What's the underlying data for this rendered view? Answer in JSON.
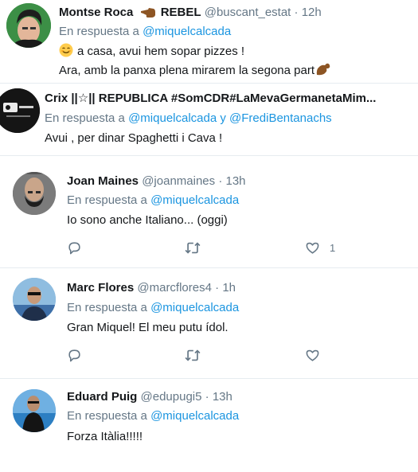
{
  "tweets": [
    {
      "name": "Montse Roca",
      "name_suffix": "REBEL",
      "handle": "@buscant_estat",
      "time": "12h",
      "reply_prefix": "En respuesta a",
      "reply_to": "@miquelcalcada",
      "line1": "a casa, avui hem sopar pizzes !",
      "line2": "Ara, amb la panxa plena mirarem la segona part"
    },
    {
      "name": "Crix ||☆|| REPUBLICA #SomCDR#LaMevaGermanetaMim...",
      "reply_prefix": "En respuesta a",
      "reply_to": "@miquelcalcada",
      "reply_and": "y",
      "reply_to2": "@FrediBentanachs",
      "line1": "Avui , per dinar Spaghetti i Cava !"
    },
    {
      "name": "Joan Maines",
      "handle": "@joanmaines",
      "time": "13h",
      "reply_prefix": "En respuesta a",
      "reply_to": "@miquelcalcada",
      "line1": "Io sono anche Italiano... (oggi)",
      "like_count": "1"
    },
    {
      "name": "Marc Flores",
      "handle": "@marcflores4",
      "time": "1h",
      "reply_prefix": "En respuesta a",
      "reply_to": "@miquelcalcada",
      "line1": "Gran Miquel! El meu putu ídol."
    },
    {
      "name": "Eduard Puig",
      "handle": "@edupugi5",
      "time": "13h",
      "reply_prefix": "En respuesta a",
      "reply_to": "@miquelcalcada",
      "line1": "Forza Itàlia!!!!!"
    }
  ],
  "separator_dot": "·",
  "colors": {
    "link": "#1b95e0",
    "muted": "#657786",
    "text": "#14171a",
    "border": "#e6ecf0"
  },
  "icons": [
    "reply-icon",
    "retweet-icon",
    "like-icon",
    "smiling-face-emoji",
    "backhand-point-left-emoji",
    "flexed-biceps-emoji"
  ]
}
